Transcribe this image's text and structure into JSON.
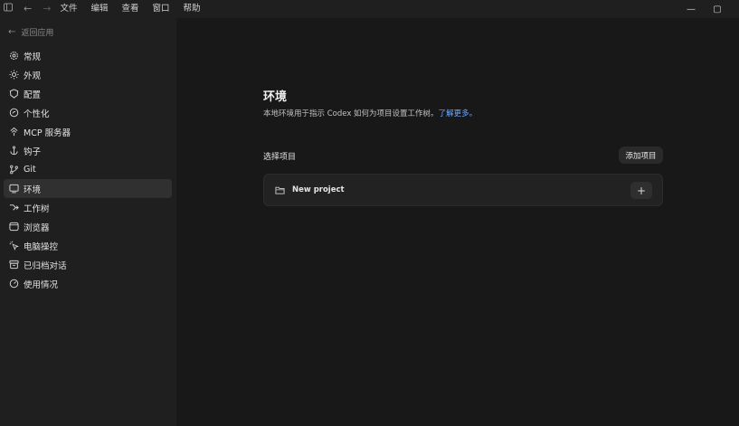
{
  "titlebar": {
    "menu": [
      "文件",
      "编辑",
      "查看",
      "窗口",
      "帮助"
    ],
    "minimize": "—",
    "maximize": "▢"
  },
  "sidebar": {
    "back_label": "返回应用",
    "items": [
      {
        "label": "常规",
        "icon": "gear-icon"
      },
      {
        "label": "外观",
        "icon": "sun-icon"
      },
      {
        "label": "配置",
        "icon": "shield-icon"
      },
      {
        "label": "个性化",
        "icon": "personalize-icon"
      },
      {
        "label": "MCP 服务器",
        "icon": "mcp-icon"
      },
      {
        "label": "钩子",
        "icon": "anchor-icon"
      },
      {
        "label": "Git",
        "icon": "git-branch-icon"
      },
      {
        "label": "环境",
        "icon": "monitor-icon",
        "active": true
      },
      {
        "label": "工作树",
        "icon": "worktree-icon"
      },
      {
        "label": "浏览器",
        "icon": "browser-icon"
      },
      {
        "label": "电脑操控",
        "icon": "computer-use-icon"
      },
      {
        "label": "已归档对话",
        "icon": "archive-icon"
      },
      {
        "label": "使用情况",
        "icon": "gauge-icon"
      }
    ]
  },
  "main": {
    "title": "环境",
    "description": "本地环境用于指示 Codex 如何为项目设置工作树。",
    "learn_more": "了解更多。",
    "section_title": "选择项目",
    "add_project": "添加项目",
    "project": {
      "name": "New project",
      "add": "+"
    }
  },
  "colors": {
    "accent_link": "#6fa8ff",
    "active_nav": "#303030",
    "background": "#181818",
    "sidebar": "#1f1f1f"
  }
}
